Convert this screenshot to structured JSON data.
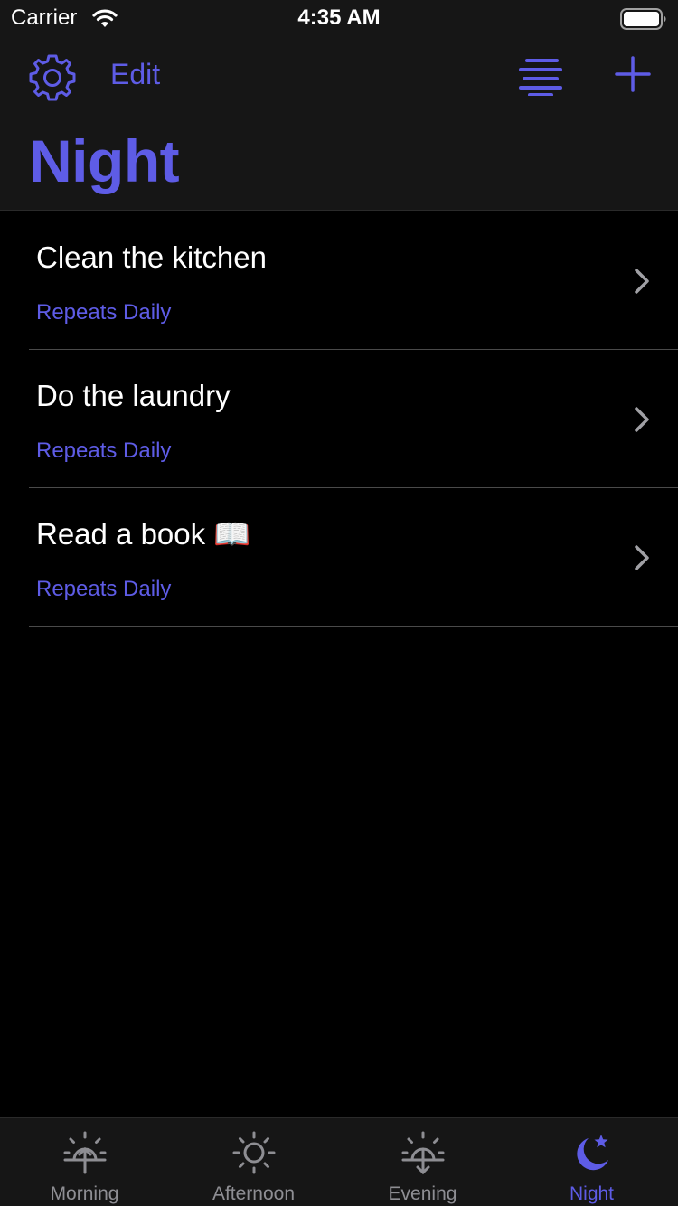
{
  "status": {
    "carrier": "Carrier",
    "time": "4:35 AM"
  },
  "header": {
    "edit_label": "Edit",
    "title": "Night"
  },
  "tasks": [
    {
      "title": "Clean the kitchen",
      "repeat": "Repeats Daily"
    },
    {
      "title": "Do the laundry",
      "repeat": "Repeats Daily"
    },
    {
      "title": "Read a book 📖",
      "repeat": "Repeats Daily"
    }
  ],
  "tabs": [
    {
      "label": "Morning",
      "icon": "sunrise-icon",
      "active": false
    },
    {
      "label": "Afternoon",
      "icon": "sun-icon",
      "active": false
    },
    {
      "label": "Evening",
      "icon": "sunset-icon",
      "active": false
    },
    {
      "label": "Night",
      "icon": "moon-star-icon",
      "active": true
    }
  ],
  "colors": {
    "accent": "#5e5ce6",
    "background": "#000000",
    "bar_background": "#161616",
    "inactive_tab": "#8e8e93",
    "separator": "#4a4a4a"
  }
}
